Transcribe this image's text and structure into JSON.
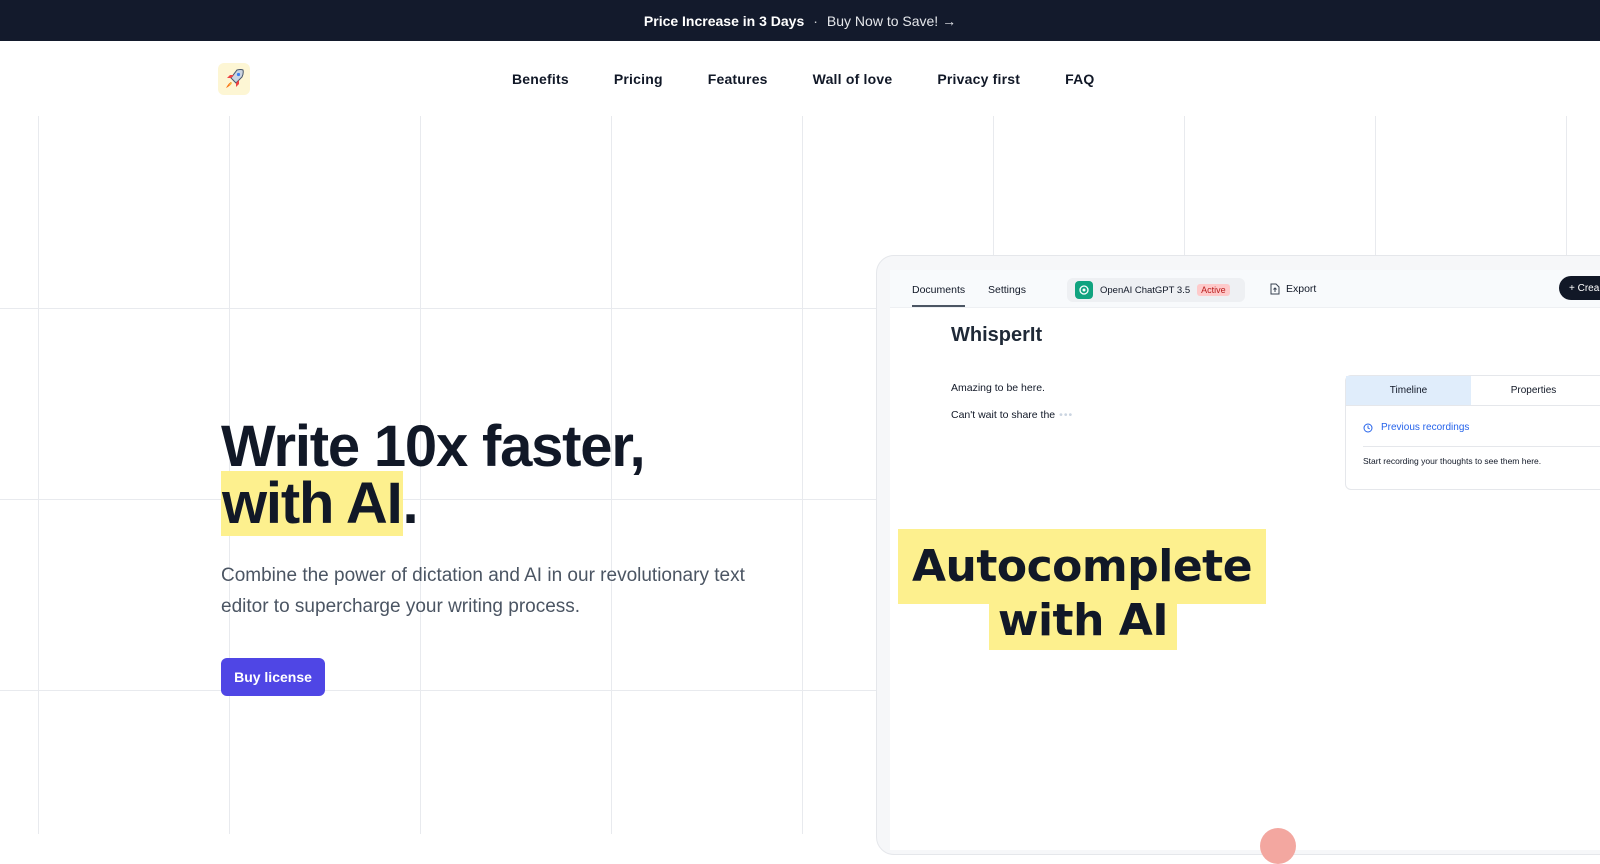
{
  "banner": {
    "headline": "Price Increase in 3 Days",
    "separator": "·",
    "cta": "Buy Now to Save! →"
  },
  "nav": {
    "logo_icon": "rocket-icon",
    "links": [
      "Benefits",
      "Pricing",
      "Features",
      "Wall of love",
      "Privacy first",
      "FAQ"
    ]
  },
  "hero": {
    "title_line1": "Write 10x faster,",
    "title_highlight": "with AI",
    "title_end": ".",
    "subtitle": "Combine the power of dictation and AI in our revolutionary text editor to supercharge your writing process.",
    "cta_label": "Buy license"
  },
  "app": {
    "tabs": [
      "Documents",
      "Settings"
    ],
    "model_name": "OpenAI ChatGPT 3.5",
    "model_status": "Active",
    "export_label": "Export",
    "create_label": "+ Crea",
    "doc_title": "WhisperIt",
    "doc_lines": [
      "Amazing to be here.",
      "Can't wait to share the"
    ],
    "panel_tabs": [
      "Timeline",
      "Properties"
    ],
    "previous_recordings": "Previous recordings",
    "panel_hint": "Start recording your thoughts to see them here.",
    "overlay_line1": "Autocomplete",
    "overlay_line2": "with AI"
  },
  "colors": {
    "banner_bg": "#131a2c",
    "highlight": "#fdf08e",
    "accent": "#4f46e5",
    "active_badge": "#fecaca"
  }
}
